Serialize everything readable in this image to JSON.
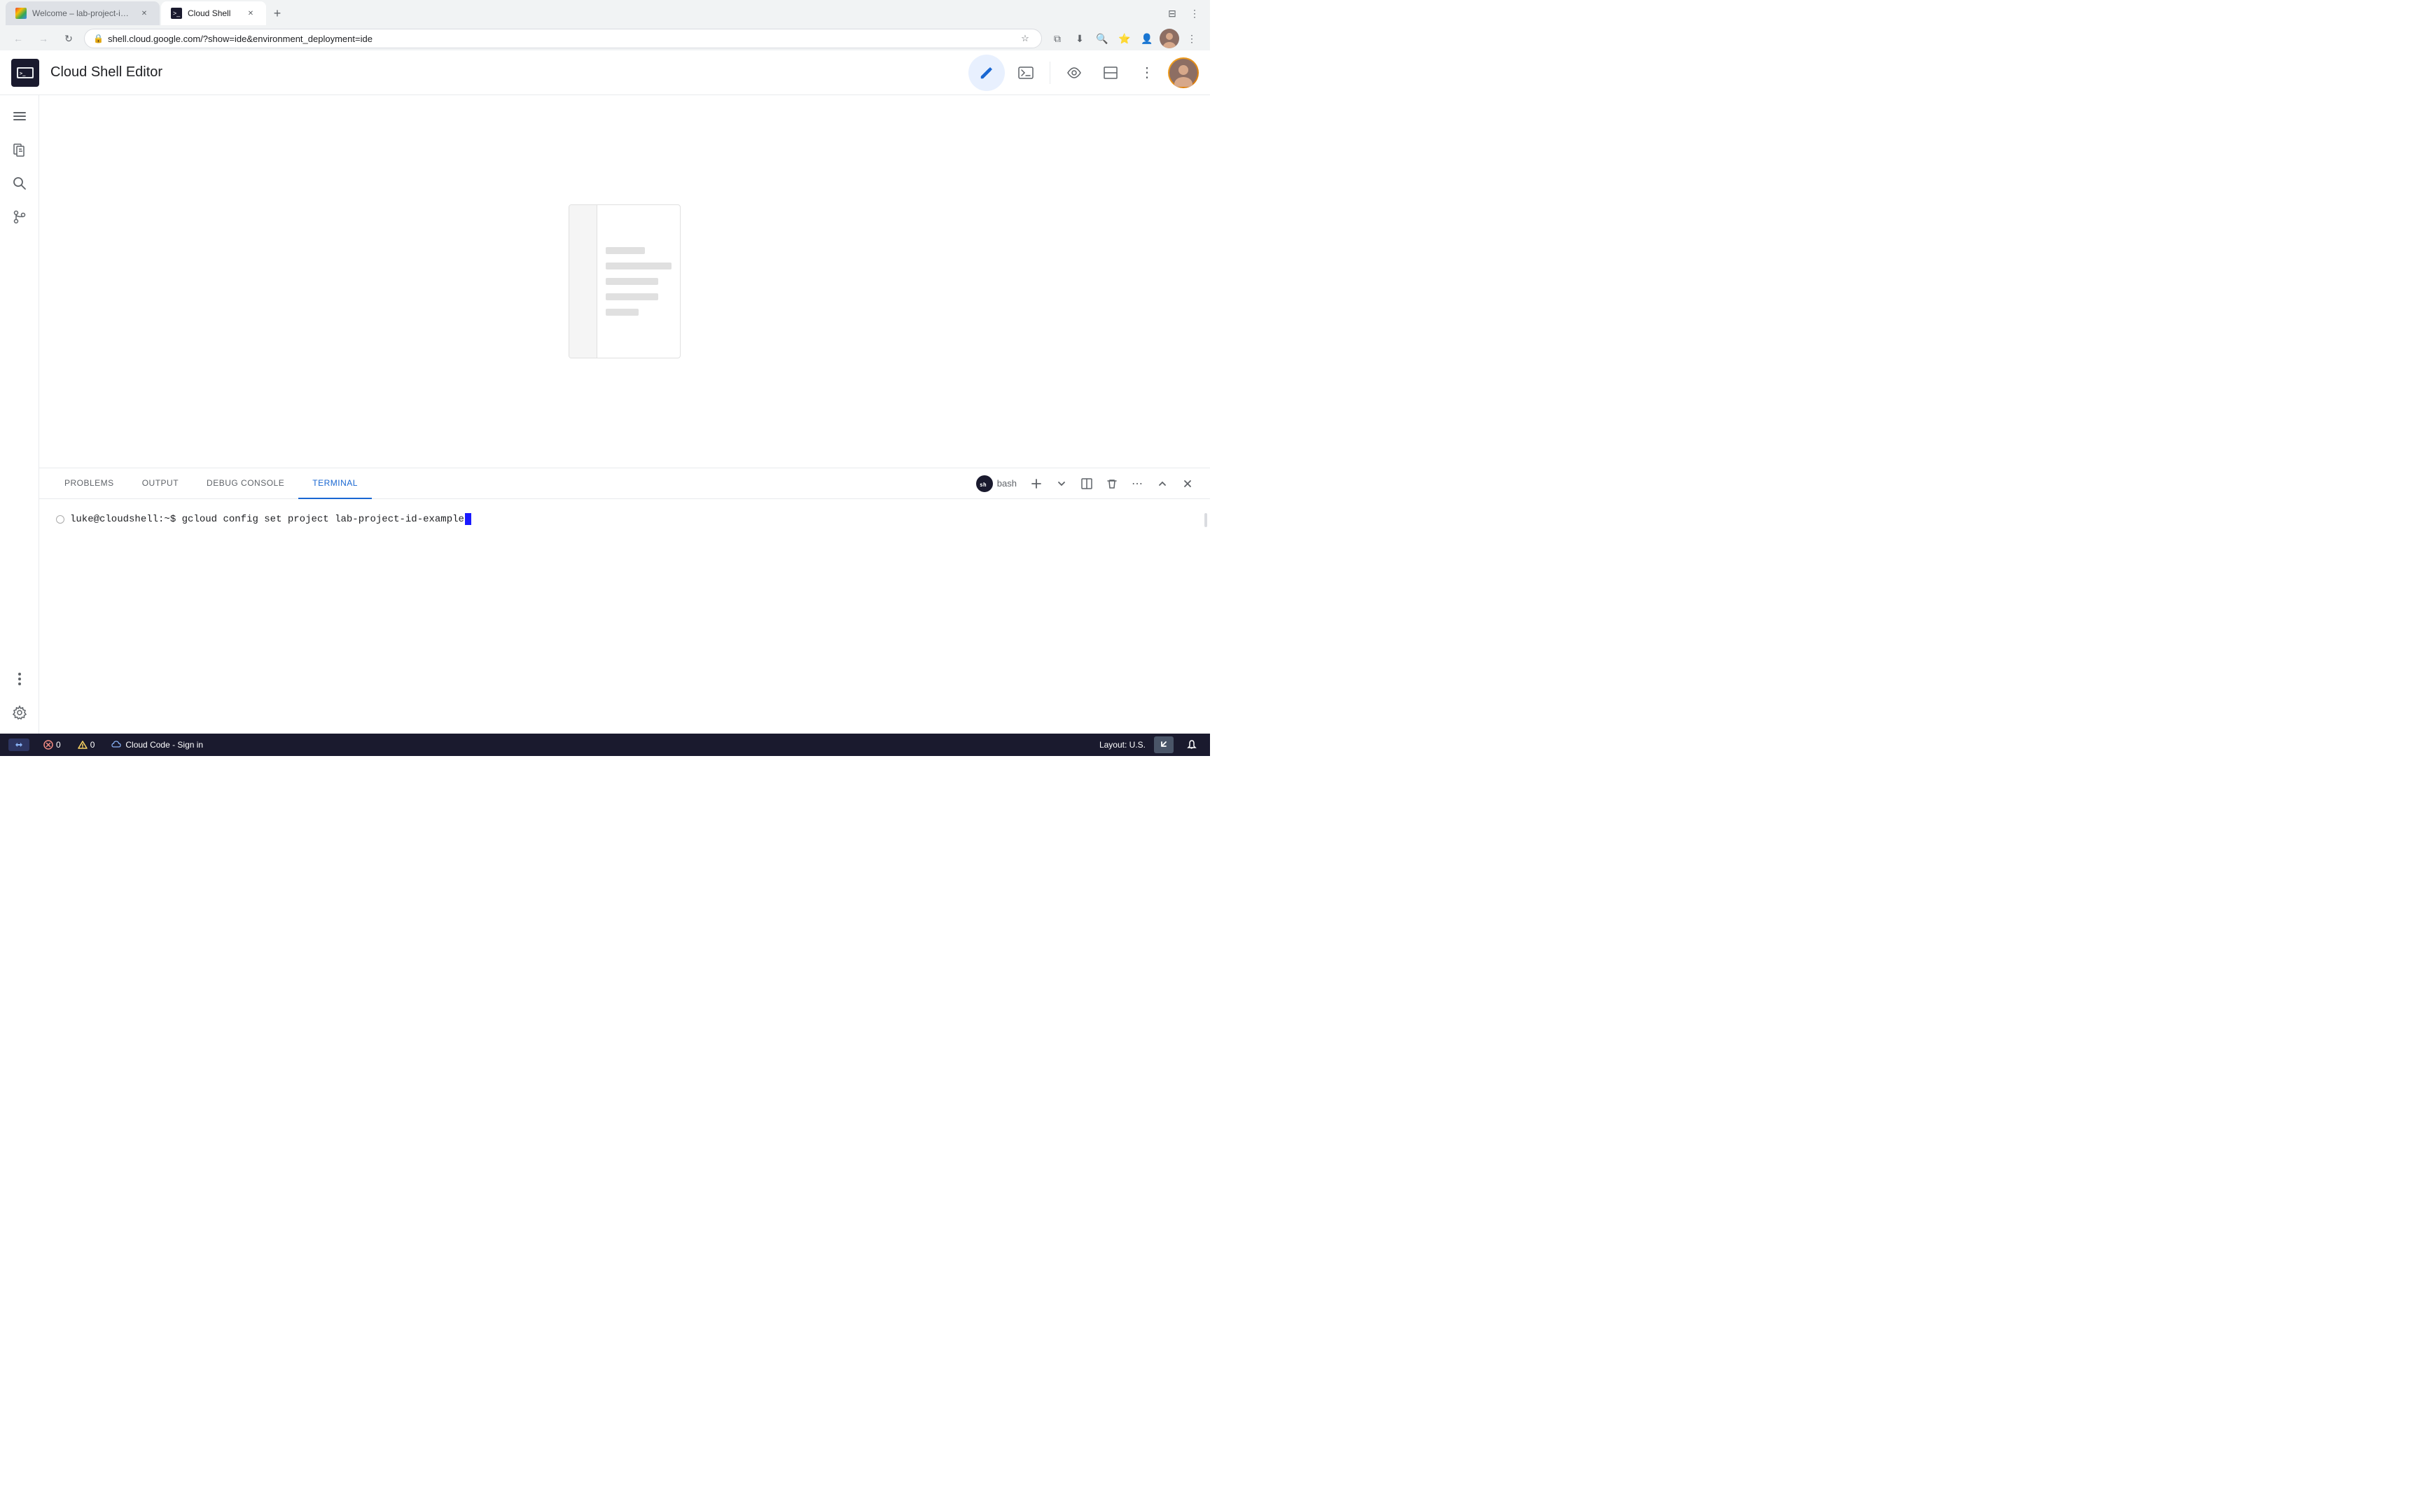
{
  "browser": {
    "tabs": [
      {
        "id": "tab1",
        "label": "Welcome – lab-project-id-ex...",
        "favicon_type": "google",
        "active": false
      },
      {
        "id": "tab2",
        "label": "Cloud Shell",
        "favicon_type": "terminal",
        "active": true
      }
    ],
    "new_tab_icon": "+",
    "url": "shell.cloud.google.com/?show=ide&environment_deployment=ide",
    "nav": {
      "back_disabled": true,
      "forward_disabled": true
    }
  },
  "header": {
    "title": "Cloud Shell Editor",
    "logo_text": ">_",
    "edit_icon": "✏",
    "terminal_icon": ">_",
    "preview_icon": "👁",
    "layout_icon": "▬",
    "more_icon": "⋮"
  },
  "sidebar": {
    "items": [
      {
        "id": "menu",
        "icon": "☰"
      },
      {
        "id": "files",
        "icon": "⧉"
      },
      {
        "id": "search",
        "icon": "🔍"
      },
      {
        "id": "git",
        "icon": "⑂"
      }
    ],
    "more_label": "..."
  },
  "editor": {
    "placeholder_lines": [
      60,
      100,
      80,
      80,
      50
    ]
  },
  "terminal": {
    "tabs": [
      {
        "id": "problems",
        "label": "PROBLEMS",
        "active": false
      },
      {
        "id": "output",
        "label": "OUTPUT",
        "active": false
      },
      {
        "id": "debug_console",
        "label": "DEBUG CONSOLE",
        "active": false
      },
      {
        "id": "terminal",
        "label": "TERMINAL",
        "active": true
      }
    ],
    "bash_label": "bash",
    "add_icon": "+",
    "chevron_icon": "▾",
    "split_icon": "⊟",
    "trash_icon": "🗑",
    "more_icon": "⋯",
    "collapse_icon": "∧",
    "close_icon": "✕",
    "prompt": {
      "user": "luke@cloudshell",
      "path": ":~$",
      "command": " gcloud config set project lab-project-id-example"
    }
  },
  "status_bar": {
    "remote_icon": "⇌",
    "remote_label": "",
    "errors_icon": "⊗",
    "errors_count": "0",
    "warnings_icon": "⚠",
    "warnings_count": "0",
    "cloud_icon": "☁",
    "cloud_label": "Cloud Code - Sign in",
    "layout_label": "Layout: U.S.",
    "arrow_icon": "↙",
    "bell_icon": "🔔"
  },
  "colors": {
    "active_tab_blue": "#1967d2",
    "terminal_bg": "#ffffff",
    "status_bar_bg": "#1a1a2e",
    "sidebar_icon": "#5f6368",
    "header_bg": "#ffffff"
  }
}
